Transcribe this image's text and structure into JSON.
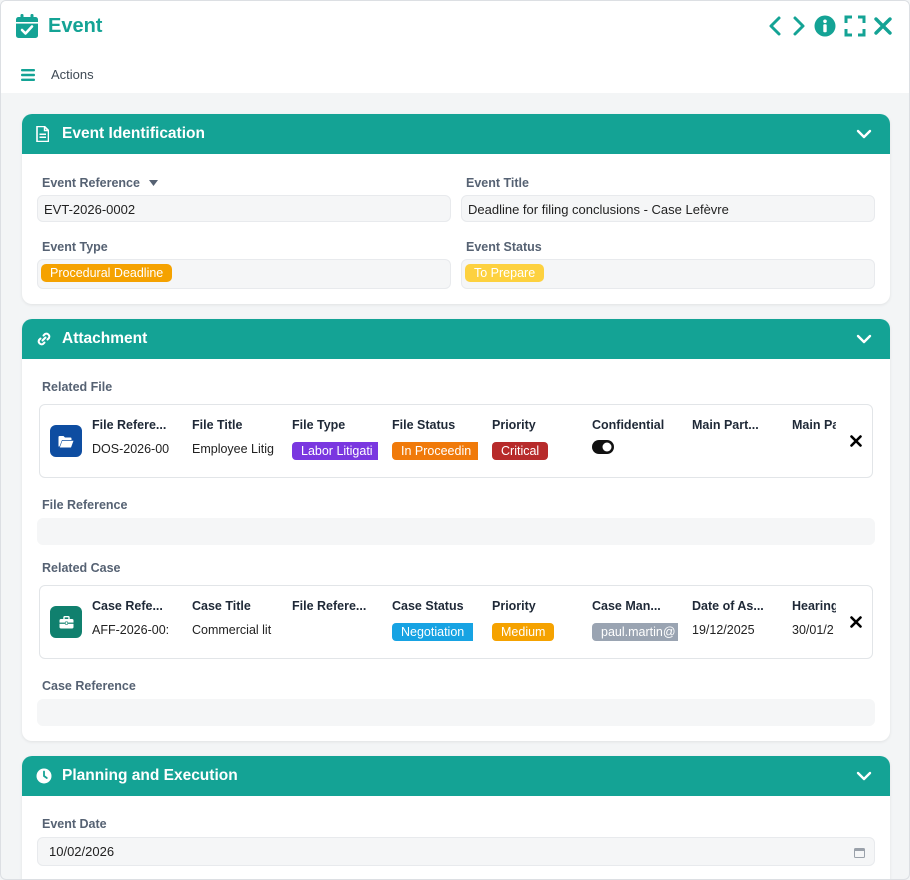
{
  "window": {
    "title": "Event",
    "actions_label": "Actions"
  },
  "colors": {
    "accent": "#14a395",
    "orange": "#f5a200",
    "yellow": "#fdd13f",
    "purple": "#7a37e0",
    "red": "#b72b2b",
    "blue": "#17a3e3",
    "gray": "#9aa4b2"
  },
  "icons": [
    "calendar-check-icon",
    "chevron-left-icon",
    "chevron-right-icon",
    "info-icon",
    "expand-icon",
    "close-icon",
    "hamburger-icon",
    "document-icon",
    "link-icon",
    "clock-icon",
    "folder-open-icon",
    "briefcase-icon",
    "calendar-icon",
    "toggle-icon"
  ],
  "identification": {
    "title": "Event Identification",
    "reference_label": "Event Reference",
    "reference_value": "EVT-2026-0002",
    "title_label": "Event Title",
    "title_value": "Deadline for filing conclusions - Case Lefèvre",
    "type_label": "Event Type",
    "type_value": "Procedural Deadline",
    "status_label": "Event Status",
    "status_value": "To Prepare"
  },
  "attachment": {
    "title": "Attachment",
    "related_file_label": "Related File",
    "file_headers": [
      "File Refere...",
      "File Title",
      "File Type",
      "File Status",
      "Priority",
      "Confidential",
      "Main Part...",
      "Main Pa"
    ],
    "file_row": {
      "reference": "DOS-2026-00",
      "title": "Employee Litig",
      "type": "Labor Litigati",
      "status": "In Proceedin",
      "priority": "Critical",
      "confidential": true
    },
    "file_reference_label": "File Reference",
    "related_case_label": "Related Case",
    "case_headers": [
      "Case Refe...",
      "Case Title",
      "File Refere...",
      "Case Status",
      "Priority",
      "Case Man...",
      "Date of As...",
      "Hearing"
    ],
    "case_row": {
      "reference": "AFF-2026-00:",
      "title": "Commercial lit",
      "file_reference": "",
      "status": "Negotiation",
      "priority": "Medium",
      "manager": "paul.martin@",
      "date_assigned": "19/12/2025",
      "hearing": "30/01/2"
    },
    "case_reference_label": "Case Reference"
  },
  "planning": {
    "title": "Planning and Execution",
    "event_date_label": "Event Date",
    "event_date_value": "10/02/2026"
  }
}
